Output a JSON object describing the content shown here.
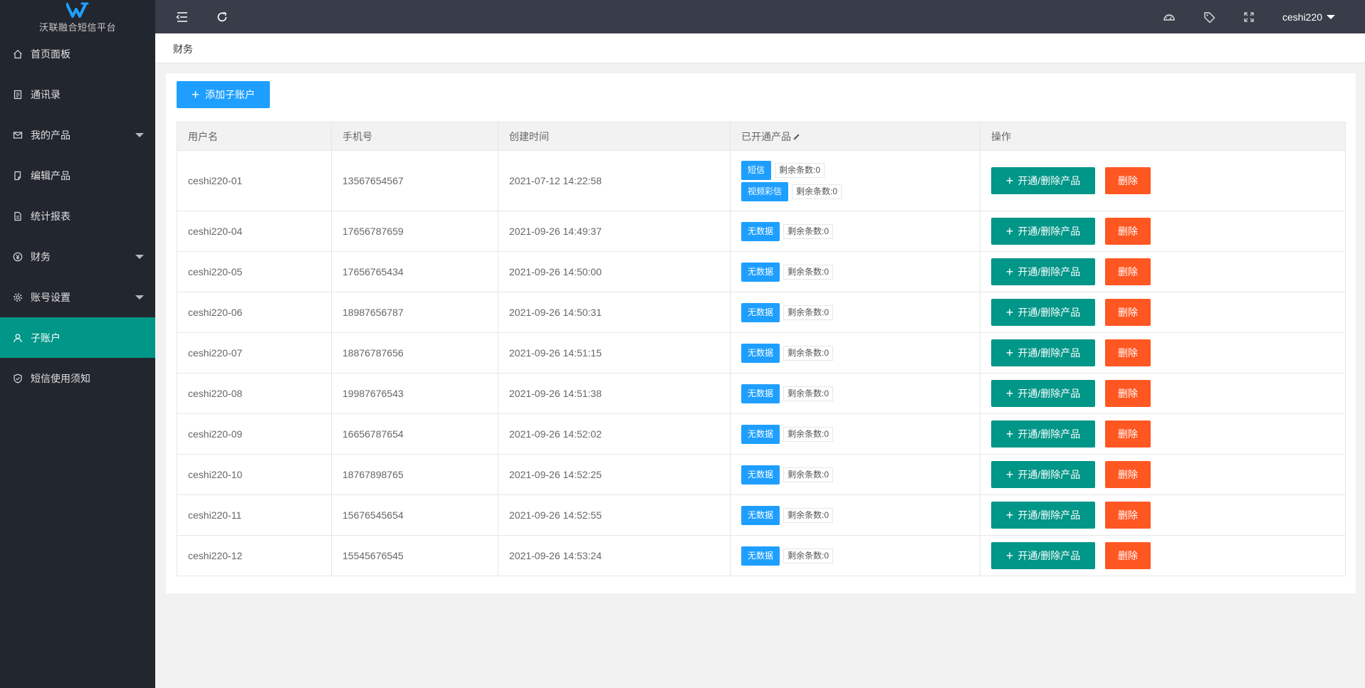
{
  "brand": {
    "name": "沃联融合短信平台"
  },
  "sidebar": {
    "items": [
      {
        "label": "首页面板",
        "icon": "home-icon"
      },
      {
        "label": "通讯录",
        "icon": "contacts-icon"
      },
      {
        "label": "我的产品",
        "icon": "mail-icon",
        "expandable": true
      },
      {
        "label": "编辑产品",
        "icon": "edit-doc-icon"
      },
      {
        "label": "统计报表",
        "icon": "report-icon"
      },
      {
        "label": "财务",
        "icon": "finance-icon",
        "expandable": true
      },
      {
        "label": "账号设置",
        "icon": "gear-icon",
        "expandable": true
      },
      {
        "label": "子账户",
        "icon": "user-icon",
        "active": true
      },
      {
        "label": "短信使用须知",
        "icon": "shield-icon"
      }
    ]
  },
  "topbar": {
    "icons": [
      "menu-fold-icon",
      "refresh-icon",
      "theme-icon",
      "tag-icon",
      "fullscreen-icon"
    ],
    "username": "ceshi220"
  },
  "breadcrumb": {
    "current": "财务"
  },
  "toolbar": {
    "add_label": "添加子账户"
  },
  "table": {
    "headers": {
      "username": "用户名",
      "phone": "手机号",
      "created": "创建时间",
      "products": "已开通产品",
      "actions": "操作"
    },
    "toggle_label": "开通/删除产品",
    "delete_label": "删除",
    "rows": [
      {
        "username": "ceshi220-01",
        "phone": "13567654567",
        "created": "2021-07-12 14:22:58",
        "products": [
          {
            "name": "短信",
            "remain": "剩余条数:0"
          },
          {
            "name": "视频彩信",
            "remain": "剩余条数:0"
          }
        ]
      },
      {
        "username": "ceshi220-04",
        "phone": "17656787659",
        "created": "2021-09-26 14:49:37",
        "products": [
          {
            "name": "无数据",
            "remain": "剩余条数:0"
          }
        ]
      },
      {
        "username": "ceshi220-05",
        "phone": "17656765434",
        "created": "2021-09-26 14:50:00",
        "products": [
          {
            "name": "无数据",
            "remain": "剩余条数:0"
          }
        ]
      },
      {
        "username": "ceshi220-06",
        "phone": "18987656787",
        "created": "2021-09-26 14:50:31",
        "products": [
          {
            "name": "无数据",
            "remain": "剩余条数:0"
          }
        ]
      },
      {
        "username": "ceshi220-07",
        "phone": "18876787656",
        "created": "2021-09-26 14:51:15",
        "products": [
          {
            "name": "无数据",
            "remain": "剩余条数:0"
          }
        ]
      },
      {
        "username": "ceshi220-08",
        "phone": "19987676543",
        "created": "2021-09-26 14:51:38",
        "products": [
          {
            "name": "无数据",
            "remain": "剩余条数:0"
          }
        ]
      },
      {
        "username": "ceshi220-09",
        "phone": "16656787654",
        "created": "2021-09-26 14:52:02",
        "products": [
          {
            "name": "无数据",
            "remain": "剩余条数:0"
          }
        ]
      },
      {
        "username": "ceshi220-10",
        "phone": "18767898765",
        "created": "2021-09-26 14:52:25",
        "products": [
          {
            "name": "无数据",
            "remain": "剩余条数:0"
          }
        ]
      },
      {
        "username": "ceshi220-11",
        "phone": "15676545654",
        "created": "2021-09-26 14:52:55",
        "products": [
          {
            "name": "无数据",
            "remain": "剩余条数:0"
          }
        ]
      },
      {
        "username": "ceshi220-12",
        "phone": "15545676545",
        "created": "2021-09-26 14:53:24",
        "products": [
          {
            "name": "无数据",
            "remain": "剩余条数:0"
          }
        ]
      }
    ]
  },
  "colors": {
    "sidebar_bg": "#22262e",
    "topbar_bg": "#393d49",
    "active": "#009688",
    "primary": "#1e9fff",
    "danger": "#ff5722"
  }
}
